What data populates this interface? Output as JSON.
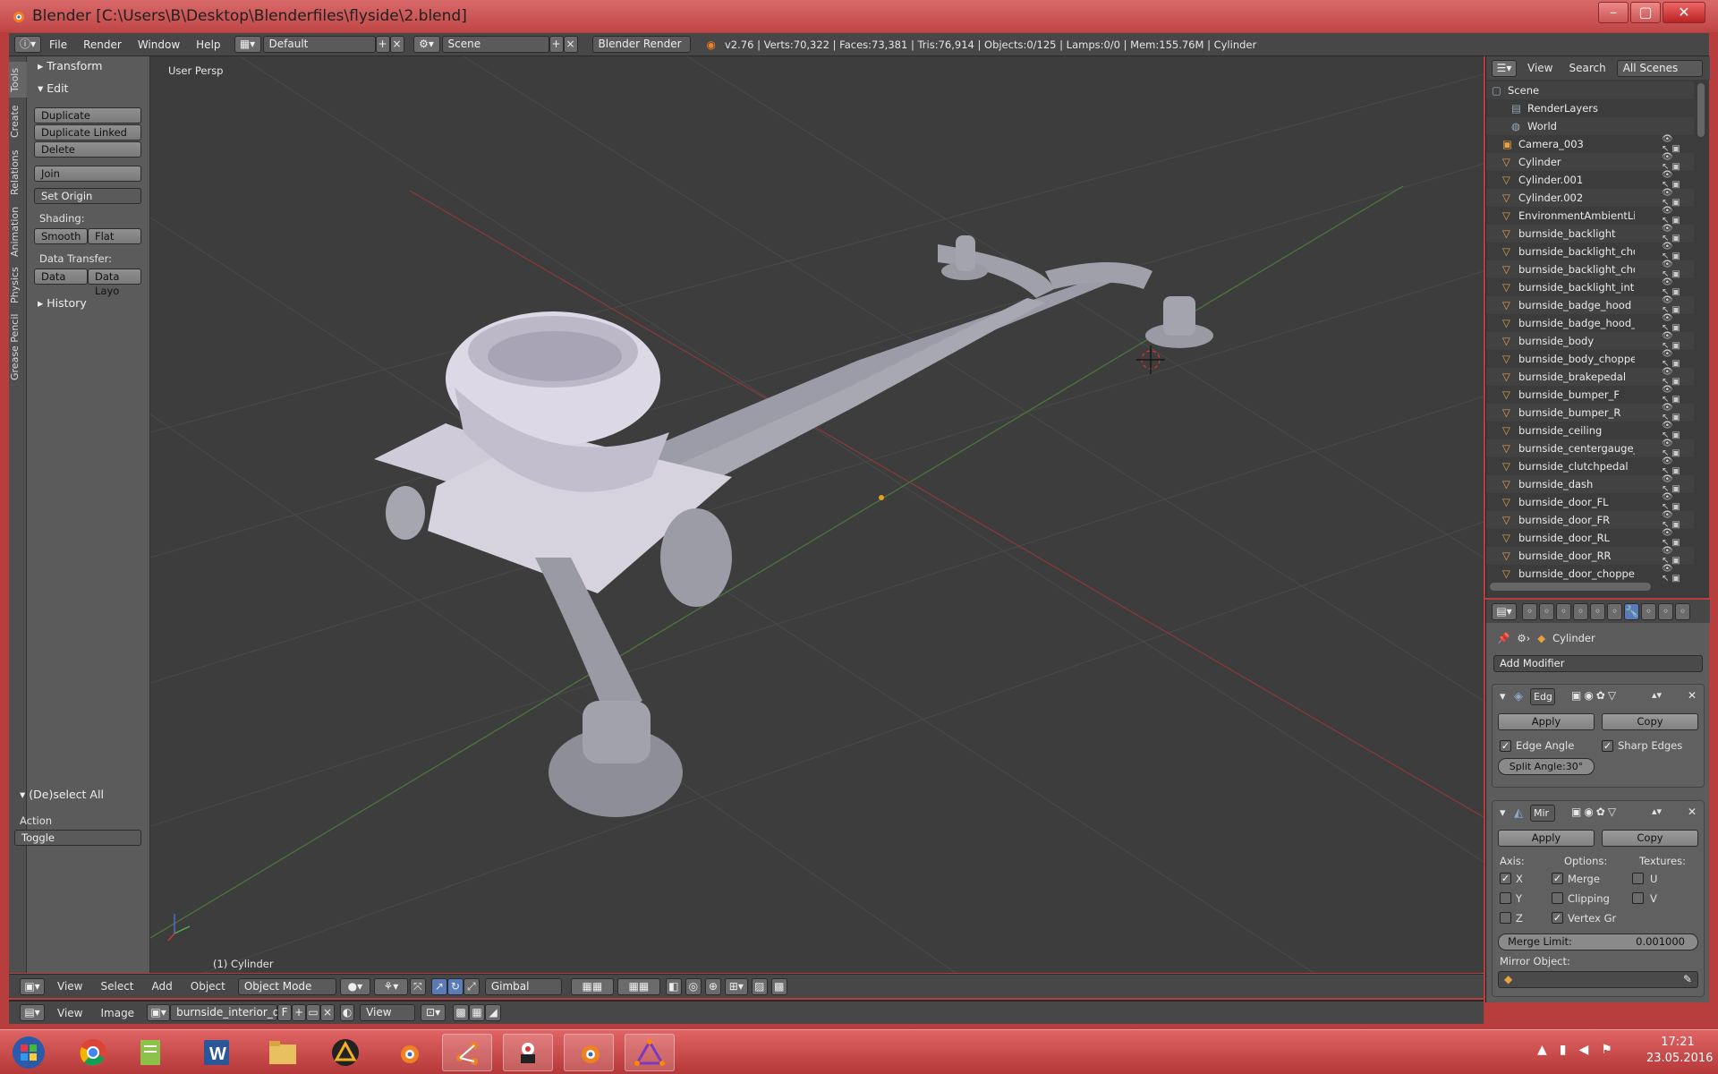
{
  "window": {
    "title": "Blender [C:\\Users\\B\\Desktop\\Blenderfiles\\flyside\\2.blend]"
  },
  "menubar": {
    "items": [
      "File",
      "Render",
      "Window",
      "Help"
    ],
    "layout": "Default",
    "scene": "Scene",
    "engine": "Blender Render",
    "stats": "v2.76 | Verts:70,322 | Faces:73,381 | Tris:76,914 | Objects:0/125 | Lamps:0/0 | Mem:155.76M | Cylinder"
  },
  "tools": {
    "tabs": [
      "Tools",
      "Create",
      "Relations",
      "Animation",
      "Physics",
      "Grease Pencil"
    ],
    "transform": "Transform",
    "edit": "Edit",
    "duplicate": "Duplicate",
    "duplicate_linked": "Duplicate Linked",
    "delete": "Delete",
    "join": "Join",
    "set_origin": "Set Origin",
    "shading": "Shading:",
    "smooth": "Smooth",
    "flat": "Flat",
    "data_transfer": "Data Transfer:",
    "data": "Data",
    "data_layo": "Data Layo",
    "history": "History",
    "deselect_all": "(De)select All",
    "action": "Action",
    "toggle": "Toggle"
  },
  "viewport": {
    "label": "User Persp",
    "object_label": "(1) Cylinder"
  },
  "view_header": {
    "items": [
      "View",
      "Select",
      "Add",
      "Object"
    ],
    "mode": "Object Mode",
    "orientation": "Gimbal"
  },
  "image_header": {
    "items": [
      "View",
      "Image"
    ],
    "image_name": "burnside_interior_d....",
    "f_label": "F",
    "view": "View"
  },
  "outliner": {
    "view": "View",
    "search": "Search",
    "filter": "All Scenes",
    "rows": [
      "Scene",
      "RenderLayers",
      "World",
      "Camera_003",
      "Cylinder",
      "Cylinder.001",
      "Cylinder.002",
      "EnvironmentAmbientLi",
      "burnside_backlight",
      "burnside_backlight_cho",
      "burnside_backlight_cho",
      "burnside_backlight_int",
      "burnside_badge_hood",
      "burnside_badge_hood_(",
      "burnside_body",
      "burnside_body_choppe",
      "burnside_brakepedal",
      "burnside_bumper_F",
      "burnside_bumper_R",
      "burnside_ceiling",
      "burnside_centergauge_",
      "burnside_clutchpedal",
      "burnside_dash",
      "burnside_door_FL",
      "burnside_door_FR",
      "burnside_door_RL",
      "burnside_door_RR",
      "burnside_door_choppe"
    ]
  },
  "properties": {
    "object_name": "Cylinder",
    "add_modifier": "Add Modifier",
    "mod1": {
      "name": "Edg",
      "apply": "Apply",
      "copy": "Copy",
      "edge_angle": "Edge Angle",
      "sharp_edges": "Sharp Edges",
      "split_angle": "Split Angle:30°"
    },
    "mod2": {
      "name": "Mir",
      "apply": "Apply",
      "copy": "Copy",
      "axis": "Axis:",
      "options": "Options:",
      "textures": "Textures:",
      "x": "X",
      "y": "Y",
      "z": "Z",
      "merge": "Merge",
      "clipping": "Clipping",
      "vertex_gr": "Vertex Gr",
      "u": "U",
      "v": "V",
      "merge_limit_label": "Merge Limit:",
      "merge_limit_value": "0.001000",
      "mirror_object": "Mirror Object:"
    }
  },
  "taskbar": {
    "time": "17:21",
    "date": "23.05.2016"
  }
}
